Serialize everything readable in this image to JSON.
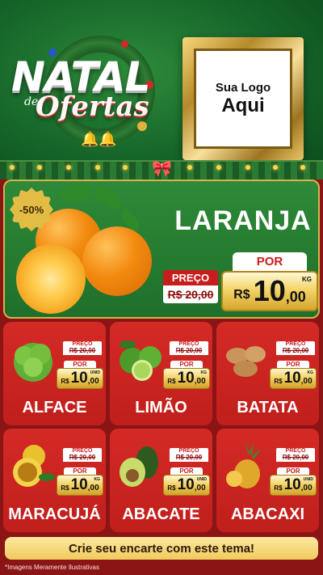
{
  "header": {
    "title_main": "NATAL",
    "title_de": "de",
    "title_sub": "Ofertas",
    "logo_line1": "Sua Logo",
    "logo_line2": "Aqui"
  },
  "hero": {
    "discount": "-50%",
    "name": "LARANJA",
    "old_label": "PREÇO",
    "old_price": "R$ 20,00",
    "new_label": "POR",
    "currency": "R$",
    "new_price_int": "10",
    "new_price_dec": ",00",
    "unit": "KG"
  },
  "products": [
    {
      "name": "ALFACE",
      "old_label": "PREÇO",
      "old_price": "R$ 20,00",
      "new_label": "POR",
      "currency": "R$",
      "int": "10",
      "dec": ",00",
      "unit": "UNID"
    },
    {
      "name": "LIMÃO",
      "old_label": "PREÇO",
      "old_price": "R$ 20,00",
      "new_label": "POR",
      "currency": "R$",
      "int": "10",
      "dec": ",00",
      "unit": "KG"
    },
    {
      "name": "BATATA",
      "old_label": "PREÇO",
      "old_price": "R$ 20,00",
      "new_label": "POR",
      "currency": "R$",
      "int": "10",
      "dec": ",00",
      "unit": "KG"
    },
    {
      "name": "MARACUJÁ",
      "old_label": "PREÇO",
      "old_price": "R$ 20,00",
      "new_label": "POR",
      "currency": "R$",
      "int": "10",
      "dec": ",00",
      "unit": "KG"
    },
    {
      "name": "ABACATE",
      "old_label": "PREÇO",
      "old_price": "R$ 20,00",
      "new_label": "POR",
      "currency": "R$",
      "int": "10",
      "dec": ",00",
      "unit": "UNID"
    },
    {
      "name": "ABACAXI",
      "old_label": "PREÇO",
      "old_price": "R$ 20,00",
      "new_label": "POR",
      "currency": "R$",
      "int": "10",
      "dec": ",00",
      "unit": "UNID"
    }
  ],
  "cta": "Crie seu encarte com este tema!",
  "disclaimer": "*Imagens Meramente Ilustrativas",
  "colors": {
    "header_green": "#1f6f2b",
    "card_red": "#c81d1d",
    "gold": "#f0cc5c"
  }
}
